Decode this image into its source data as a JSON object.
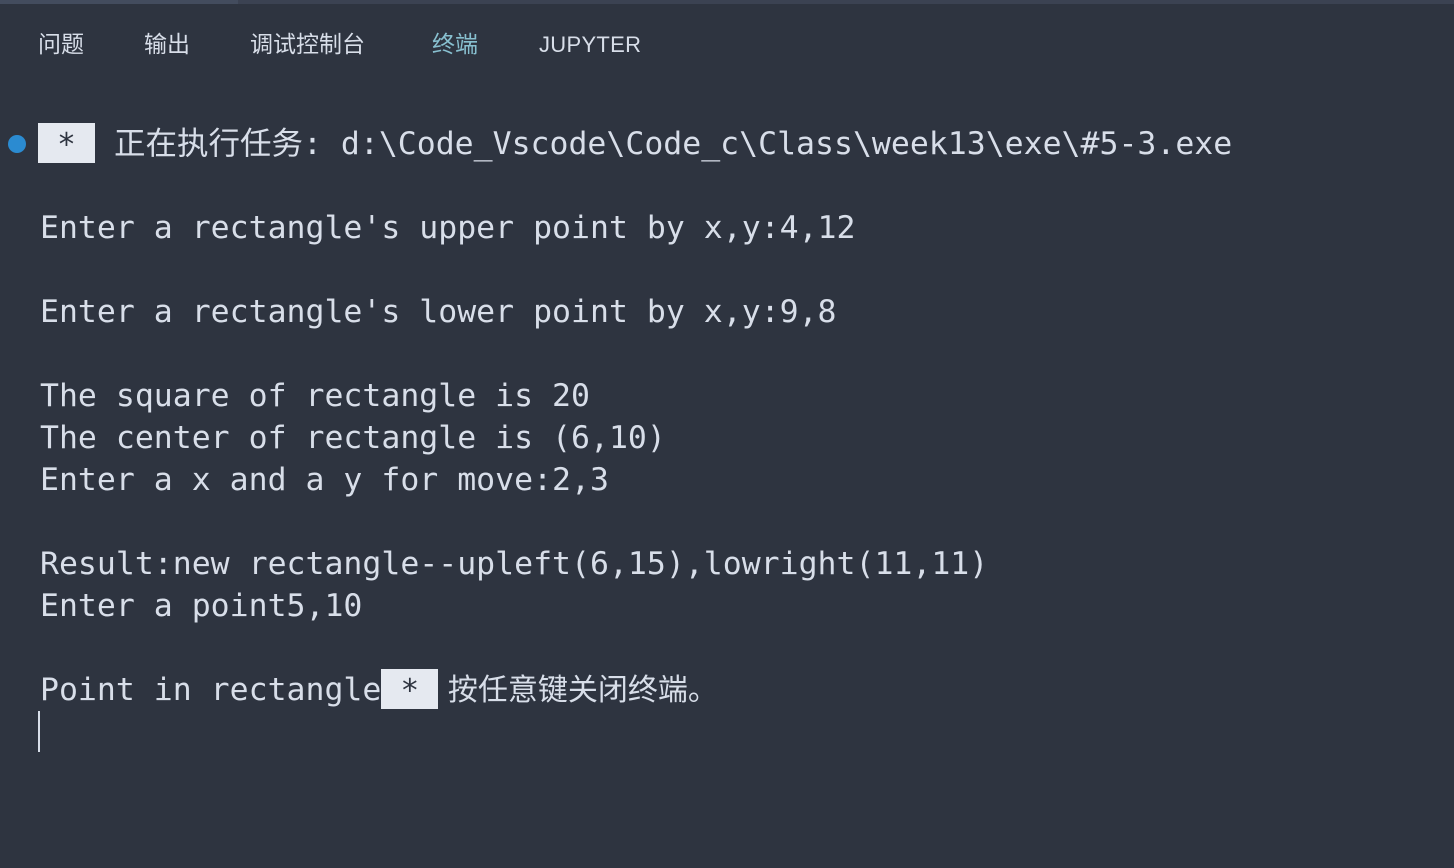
{
  "panel": {
    "tabs": [
      {
        "label": "问题"
      },
      {
        "label": "输出"
      },
      {
        "label": "调试控制台"
      },
      {
        "label": "终端",
        "active": true
      },
      {
        "label": "JUPYTER"
      }
    ]
  },
  "terminal": {
    "task_star": "*",
    "task_text": " 正在执行任务: d:\\Code_Vscode\\Code_c\\Class\\week13\\exe\\#5-3.exe",
    "lines": [
      "Enter a rectangle's upper point by x,y:4,12",
      "Enter a rectangle's lower point by x,y:9,8",
      "The square of rectangle is 20",
      "The center of rectangle is (6,10)",
      "Enter a x and a y for move:2,3",
      "Result:new rectangle--upleft(6,15),lowright(11,11)",
      "Enter a point5,10",
      "Point in rectangle"
    ],
    "close_star": "*",
    "close_text": " 按任意键关闭终端。"
  },
  "colors": {
    "background": "#2e3440",
    "text": "#d8dee9",
    "active_tab": "#88c0d0",
    "status_dot": "#2b8bd1"
  }
}
